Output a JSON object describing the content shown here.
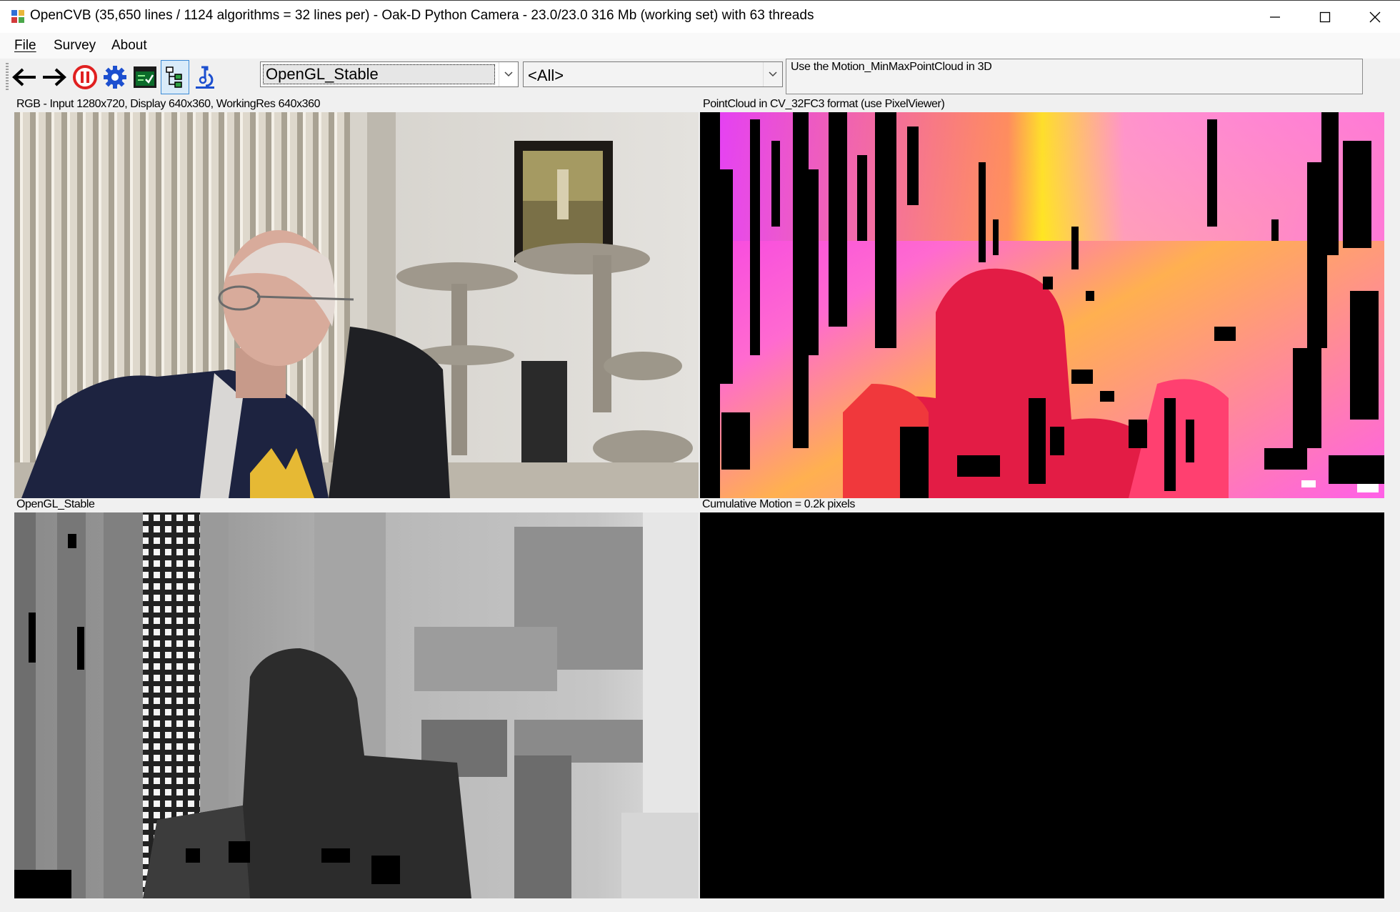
{
  "window": {
    "title": "OpenCVB (35,650 lines / 1124 algorithms = 32 lines per) - Oak-D Python Camera - 23.0/23.0 316 Mb (working set) with 63 threads"
  },
  "menu": {
    "file": "File",
    "survey": "Survey",
    "about": "About"
  },
  "toolbar": {
    "icons": [
      "back-arrow-icon",
      "forward-arrow-icon",
      "pause-icon",
      "gear-icon",
      "test-all-icon",
      "tree-view-icon",
      "pixel-viewer-icon"
    ],
    "algorithm_selected": "OpenGL_Stable",
    "group_selected": "<All>",
    "description": "Use the Motion_MinMaxPointCloud in 3D"
  },
  "panels": {
    "rgb_label": "RGB - Input 1280x720, Display 640x360, WorkingRes 640x360",
    "pointcloud_label": "PointCloud in CV_32FC3 format (use PixelViewer)",
    "opengl_label": "OpenGL_Stable",
    "motion_label": "Cumulative Motion = 0.2k pixels"
  },
  "colors": {
    "accent_selected": "#3d8bd6",
    "pause_red": "#e02020",
    "gear_blue": "#1c4fcf"
  }
}
